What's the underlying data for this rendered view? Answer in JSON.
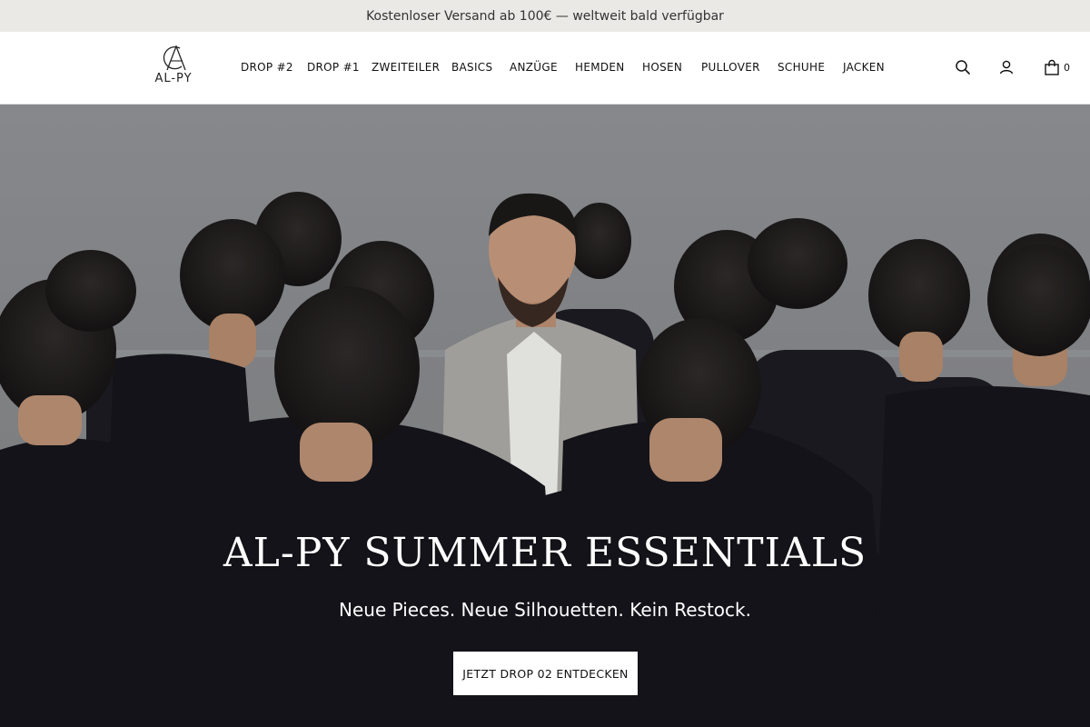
{
  "announcement": {
    "text": "Kostenloser Versand ab 100€ — weltweit bald verfügbar"
  },
  "brand": {
    "logo_text": "AL-PY"
  },
  "nav": {
    "items": [
      {
        "label": "DROP #2"
      },
      {
        "label": "DROP #1"
      },
      {
        "label": "ZWEITEILER"
      },
      {
        "label": "BASICS"
      },
      {
        "label": "ANZÜGE"
      },
      {
        "label": "HEMDEN"
      },
      {
        "label": "HOSEN"
      },
      {
        "label": "PULLOVER"
      },
      {
        "label": "SCHUHE"
      },
      {
        "label": "JACKEN"
      }
    ]
  },
  "header_icons": {
    "search": "search-icon",
    "account": "user-icon",
    "cart": "shopping-bag-icon",
    "cart_count": "0"
  },
  "hero": {
    "title": "AL-PY SUMMER ESSENTIALS",
    "subtitle": "Neue Pieces. Neue Silhouetten. Kein Restock.",
    "cta_label": "JETZT DROP 02 ENTDECKEN"
  },
  "colors": {
    "announcement_bg": "#ebe9e6",
    "header_bg": "#ffffff",
    "hero_bg": "#8a8c8f",
    "cta_bg": "#ffffff",
    "text_light": "#ffffff"
  }
}
